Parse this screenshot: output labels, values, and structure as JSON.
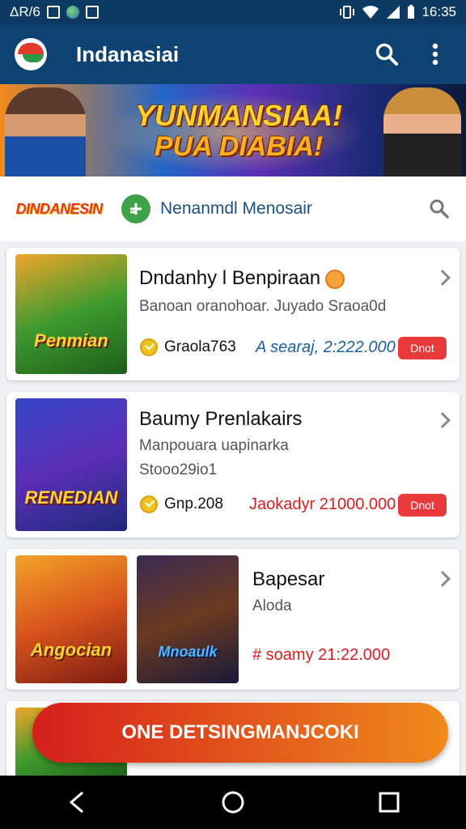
{
  "status": {
    "carrier": "ΔR/6",
    "time": "16:35"
  },
  "appbar": {
    "title": "Indanasiai",
    "search_icon": "search-icon",
    "menu_icon": "more-vert-icon"
  },
  "banner": {
    "line1": "YUNMANSIAA!",
    "line2": "PUA DIABIA!"
  },
  "searchbar": {
    "brand": "DINDANESIN",
    "text": "Nenanmdl Menosair"
  },
  "cards": [
    {
      "title": "Dndanhy l Benpiraan",
      "subtitle": "Banoan oranohoar. Juyado Sraoa0d",
      "thumb_label": "Penmian",
      "coins": "Graola763",
      "price": "A searaj, 2:222.000",
      "button": "Dnot"
    },
    {
      "title": "Baumy Prenlakairs",
      "subtitle": "Manpouara uapinarka",
      "subtitle2": "Stooo29io1",
      "thumb_label": "RENEDIAN",
      "coins": "Gnp.208",
      "price": "Jaokadyr 21000.000",
      "button": "Dnot"
    },
    {
      "title": "Bapesar",
      "subtitle": "Aloda",
      "thumb_label": "Angocian",
      "thumb_label2": "Mnoaulk",
      "price": "# soamy 21:22.000"
    }
  ],
  "cta": {
    "label": "ONE DETSINGMANJCOKI"
  },
  "colors": {
    "appbar": "#0e4272",
    "accent_red": "#e9393a",
    "price_blue": "#1b5fa6",
    "price_red": "#d81f1f",
    "green": "#3ea24b"
  }
}
